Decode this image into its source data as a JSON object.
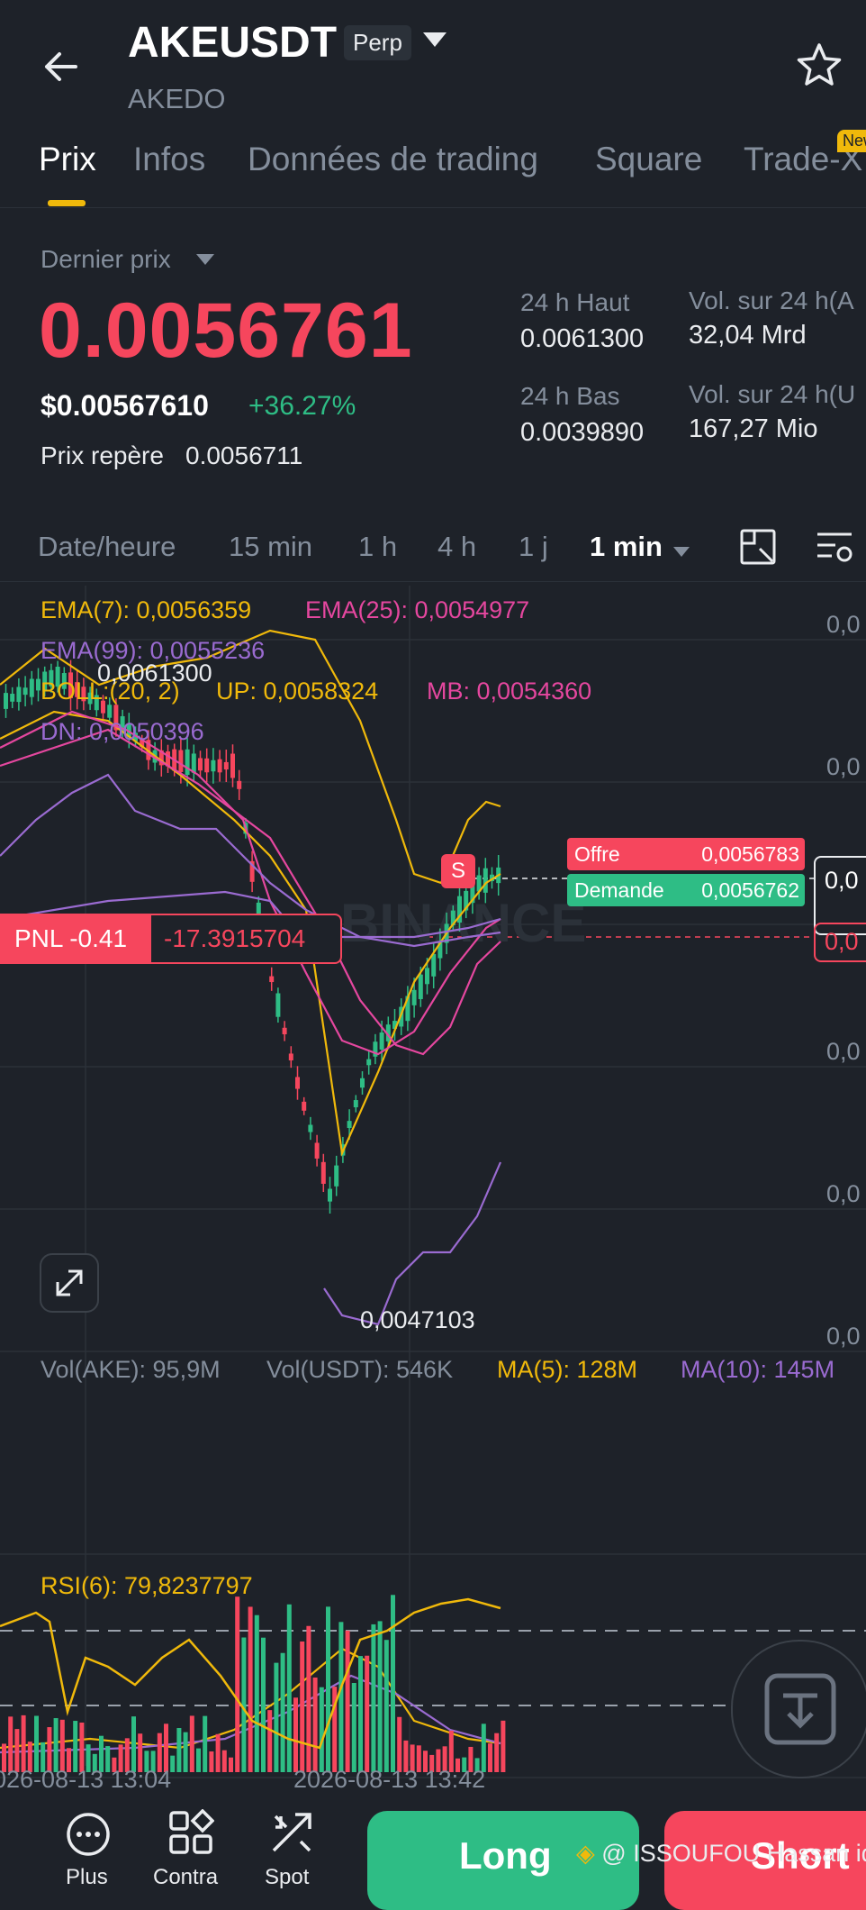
{
  "header": {
    "symbol": "AKEUSDT",
    "contract_type": "Perp",
    "name": "AKEDO"
  },
  "tabs": [
    {
      "label": "Prix",
      "active": true
    },
    {
      "label": "Infos"
    },
    {
      "label": "Données de trading"
    },
    {
      "label": "Square"
    },
    {
      "label": "Trade-X"
    }
  ],
  "new_badge": "New",
  "ticker": {
    "last_price_label": "Dernier prix",
    "last_price": "0.0056761",
    "usd_price": "$0.00567610",
    "change_pct": "+36.27%",
    "mark_label": "Prix repère",
    "mark_price": "0.0056711",
    "high_label": "24 h Haut",
    "high": "0.0061300",
    "low_label": "24 h Bas",
    "low": "0.0039890",
    "vol_a_label": "Vol. sur 24 h(A",
    "vol_a": "32,04 Mrd",
    "vol_u_label": "Vol. sur 24 h(U",
    "vol_u": "167,27 Mio"
  },
  "timeframes": {
    "date_time": "Date/heure",
    "items": [
      "15 min",
      "1 h",
      "4 h",
      "1 j"
    ],
    "active": "1 min"
  },
  "indicators": {
    "ema7": "EMA(7): 0,0056359",
    "ema25": "EMA(25): 0,0054977",
    "ema99": "EMA(99): 0,0055236",
    "boll": "BOLL:(20, 2)",
    "up": "UP: 0,0058324",
    "mb": "MB: 0,0054360",
    "dn": "DN: 0,0050396"
  },
  "chart_marks": {
    "high_marker": "0,0061300",
    "low_marker": "0,0047103",
    "sell_marker": "S",
    "offer_label": "Offre",
    "offer_value": "0,0056783",
    "bid_label": "Demande",
    "bid_value": "0,0056762",
    "pnl_label": "PNL -0.41",
    "pnl_value": "-17.3915704",
    "axis_tick": "0,0",
    "axis_tick_cut": "0,0",
    "watermark": "BINANCE"
  },
  "volume": {
    "vol_ake": "Vol(AKE): 95,9M",
    "vol_usdt": "Vol(USDT): 546K",
    "ma5": "MA(5): 128M",
    "ma10": "MA(10): 145M"
  },
  "rsi": {
    "label": "RSI(6): 79,8237797"
  },
  "time_axis": {
    "t1": "026-08-13 13:04",
    "t2": "2026-08-13 13:42"
  },
  "bottom": {
    "more": "Plus",
    "contract": "Contra",
    "spot": "Spot",
    "long": "Long",
    "short": "Short",
    "credit": "@ ISSOUFOU Hassan ide"
  },
  "colors": {
    "up": "#2ebd85",
    "down": "#f6465d",
    "accent": "#f0b90b",
    "ema25": "#e5479f",
    "ema99": "#9a6bd1",
    "bg": "#1e2229"
  }
}
